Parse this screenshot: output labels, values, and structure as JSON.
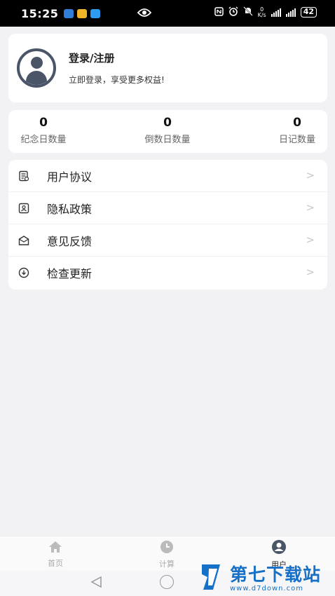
{
  "status_bar": {
    "time": "15:25",
    "net_speed_value": "0",
    "net_speed_unit": "K/s",
    "battery": "42"
  },
  "profile": {
    "title": "登录/注册",
    "subtitle": "立即登录，享受更多权益!"
  },
  "stats": [
    {
      "value": "0",
      "label": "纪念日数量"
    },
    {
      "value": "0",
      "label": "倒数日数量"
    },
    {
      "value": "0",
      "label": "日记数量"
    }
  ],
  "menu": [
    {
      "label": "用户协议",
      "icon": "document-icon"
    },
    {
      "label": "隐私政策",
      "icon": "privacy-icon"
    },
    {
      "label": "意见反馈",
      "icon": "mail-icon"
    },
    {
      "label": "检查更新",
      "icon": "download-icon"
    }
  ],
  "chevron": ">",
  "tabbar": {
    "items": [
      {
        "label": "首页",
        "icon": "home-icon"
      },
      {
        "label": "计算",
        "icon": "clock-icon"
      },
      {
        "label": "用户",
        "icon": "user-icon",
        "active": true
      }
    ]
  },
  "watermark": {
    "brand": "第七下载站",
    "url": "www.d7down.com"
  },
  "colors": {
    "background": "#f2f2f4",
    "card": "#ffffff",
    "accent_watermark": "#1770c8",
    "avatar": "#4a5568",
    "tab_inactive": "#aaaaaa"
  }
}
